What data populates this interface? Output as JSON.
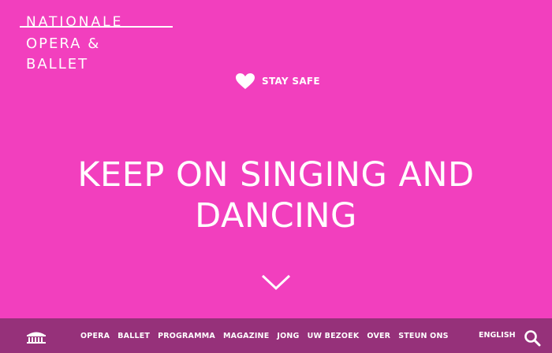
{
  "logo": {
    "line1": "NATIONALE",
    "line2": "OPERA &",
    "line3": "BALLET"
  },
  "stay_safe": {
    "label": "STAY SAFE",
    "icon": "heart-icon"
  },
  "hero": {
    "line1": "KEEP ON SINGING AND",
    "line2": "DANCING"
  },
  "scroll": {
    "icon": "chevron-down-icon"
  },
  "nav": {
    "home_icon": "theater-building-icon",
    "items": [
      "OPERA",
      "BALLET",
      "PROGRAMMA",
      "MAGAZINE",
      "JONG",
      "UW BEZOEK",
      "OVER",
      "STEUN ONS"
    ],
    "language": "ENGLISH",
    "search_icon": "search-icon"
  },
  "colors": {
    "background": "#f23fbe",
    "navbar": "#96317a",
    "text": "#ffffff"
  }
}
